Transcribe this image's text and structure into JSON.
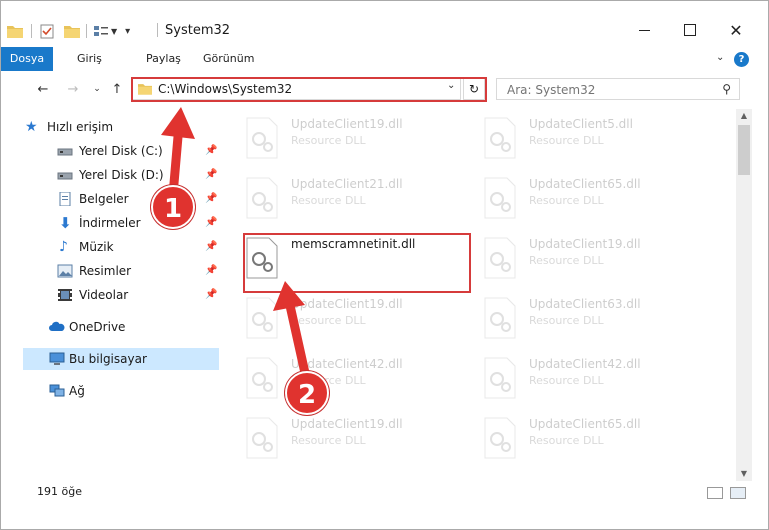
{
  "window": {
    "title": "System32"
  },
  "ribbon": {
    "tabs": [
      "Dosya",
      "Giriş",
      "Paylaş",
      "Görünüm"
    ],
    "help": "?"
  },
  "address": {
    "path": "C:\\Windows\\System32"
  },
  "search": {
    "placeholder": "Ara: System32"
  },
  "sidebar": {
    "items": [
      {
        "label": "Hızlı erişim"
      },
      {
        "label": "Yerel Disk (C:)"
      },
      {
        "label": "Yerel Disk (D:)"
      },
      {
        "label": "Belgeler"
      },
      {
        "label": "İndirmeler"
      },
      {
        "label": "Müzik"
      },
      {
        "label": "Resimler"
      },
      {
        "label": "Videolar"
      },
      {
        "label": "OneDrive"
      },
      {
        "label": "Bu bilgisayar"
      },
      {
        "label": "Ağ"
      }
    ]
  },
  "files": {
    "left": [
      {
        "name": "UpdateClient19.dll",
        "type": "Resource DLL"
      },
      {
        "name": "UpdateClient21.dll",
        "type": "Resource DLL"
      },
      {
        "name": "memscramnetinit.dll",
        "type": ""
      },
      {
        "name": "UpdateClient19.dll",
        "type": "Resource DLL"
      },
      {
        "name": "UpdateClient42.dll",
        "type": "Resource DLL"
      },
      {
        "name": "UpdateClient19.dll",
        "type": "Resource DLL"
      }
    ],
    "right": [
      {
        "name": "UpdateClient5.dll",
        "type": "Resource DLL"
      },
      {
        "name": "UpdateClient65.dll",
        "type": "Resource DLL"
      },
      {
        "name": "UpdateClient19.dll",
        "type": "Resource DLL"
      },
      {
        "name": "UpdateClient63.dll",
        "type": "Resource DLL"
      },
      {
        "name": "UpdateClient42.dll",
        "type": "Resource DLL"
      },
      {
        "name": "UpdateClient65.dll",
        "type": "Resource DLL"
      }
    ]
  },
  "status": {
    "count": "191 öğe"
  },
  "annotations": {
    "step1": "1",
    "step2": "2",
    "color": "#d63b3b"
  }
}
